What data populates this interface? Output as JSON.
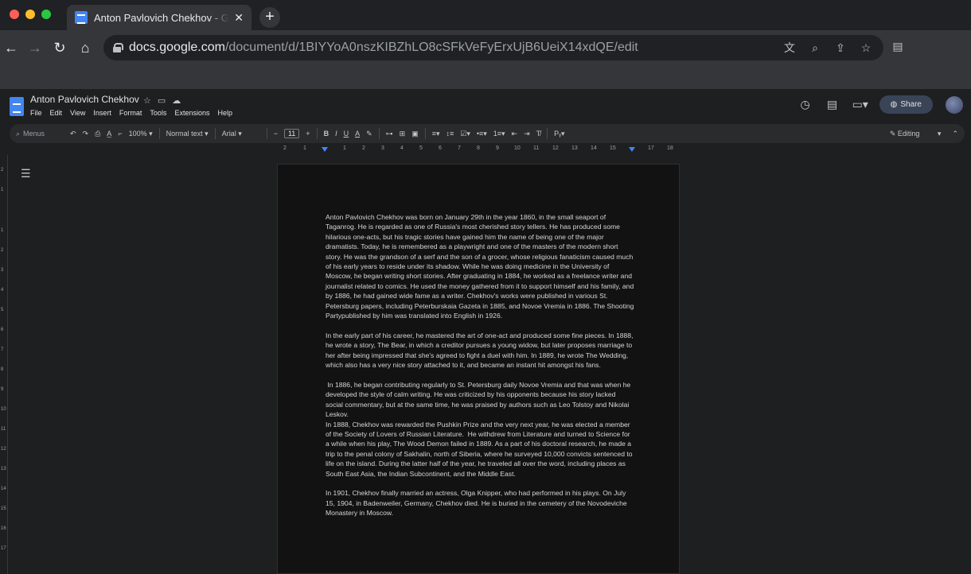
{
  "browser": {
    "tab_title": "Anton Pavlovich Chekhov - Google Docs",
    "tab_close": "✕",
    "new_tab": "+",
    "url_host": "docs.google.com",
    "url_path": "/document/d/1BIYYoA0nszKIBZhLO8cSFkVeFyErxUjB6UeiX14xdQE/edit"
  },
  "docs": {
    "title": "Anton Pavlovich Chekhov",
    "menu": [
      "File",
      "Edit",
      "View",
      "Insert",
      "Format",
      "Tools",
      "Extensions",
      "Help"
    ],
    "share_label": "Share"
  },
  "format_toolbar": {
    "search_placeholder": "Menus",
    "zoom": "100%",
    "style": "Normal text",
    "font": "Arial",
    "font_size": "11",
    "mode": "Editing"
  },
  "ruler_marks": [
    "2",
    "1",
    "1",
    "2",
    "3",
    "4",
    "5",
    "6",
    "7",
    "8",
    "9",
    "10",
    "11",
    "12",
    "13",
    "14",
    "15",
    "16",
    "17",
    "18"
  ],
  "vruler_marks": [
    "2",
    "1",
    "1",
    "2",
    "3",
    "4",
    "5",
    "6",
    "7",
    "8",
    "9",
    "10",
    "11",
    "12",
    "13",
    "14",
    "15",
    "16",
    "17"
  ],
  "document": {
    "paragraphs": [
      "Anton Pavlovich Chekhov was born on January 29th in the year 1860, in the small seaport of Taganrog. He is regarded as one of Russia's most cherished story tellers. He has produced some hilarious one-acts, but his tragic stories have gained him the name of being one of the major dramatists. Today, he is remembered as a playwright and one of the masters of the modern short story. He was the grandson of a serf and the son of a grocer, whose religious fanaticism caused much of his early years to reside under its shadow. While he was doing medicine in the University of Moscow, he began writing short stories. After graduating in 1884, he worked as a freelance writer and journalist related to comics. He used the money gathered from it to support himself and his family, and by 1886, he had gained wide fame as a writer. Chekhov's works were published in various St. Petersburg papers, including Peterburskaia Gazeta in 1885, and Novoe Vremia in 1886. The Shooting Partypublished by him was translated into English in 1926.",
      "In the early part of his career, he mastered the art of one-act and produced some fine pieces. In 1888, he wrote a story, The Bear, in which a creditor pursues a young widow, but later proposes marriage to her after being impressed that she's agreed to fight a duel with him. In 1889, he wrote The Wedding, which also has a very nice story attached to it, and became an instant hit amongst his fans.",
      " In 1886, he began contributing regularly to St. Petersburg daily Novoe Vremia and that was when he developed the style of calm writing. He was criticized by his opponents because his story lacked social commentary, but at the same time, he was praised by authors such as Leo Tolstoy and Nikolai Leskov.",
      "In 1888, Chekhov was rewarded the Pushkin Prize and the very next year, he was elected a member of the Society of Lovers of Russian Literature.  He withdrew from Literature and turned to Science for a while when his play, The Wood Demon failed in 1889. As a part of his doctoral research, he made a trip to the penal colony of Sakhalin, north of Siberia, where he surveyed 10,000 convicts sentenced to life on the island. During the latter half of the year, he traveled all over the word, including places as South East Asia, the Indian Subcontinent, and the Middle East.",
      "In 1901, Chekhov finally married an actress, Olga Knipper, who had performed in his plays. On July 15, 1904, in Badenweiler, Germany, Chekhov died. He is buried in the cemetery of the Novodeviche Monastery in Moscow."
    ]
  }
}
